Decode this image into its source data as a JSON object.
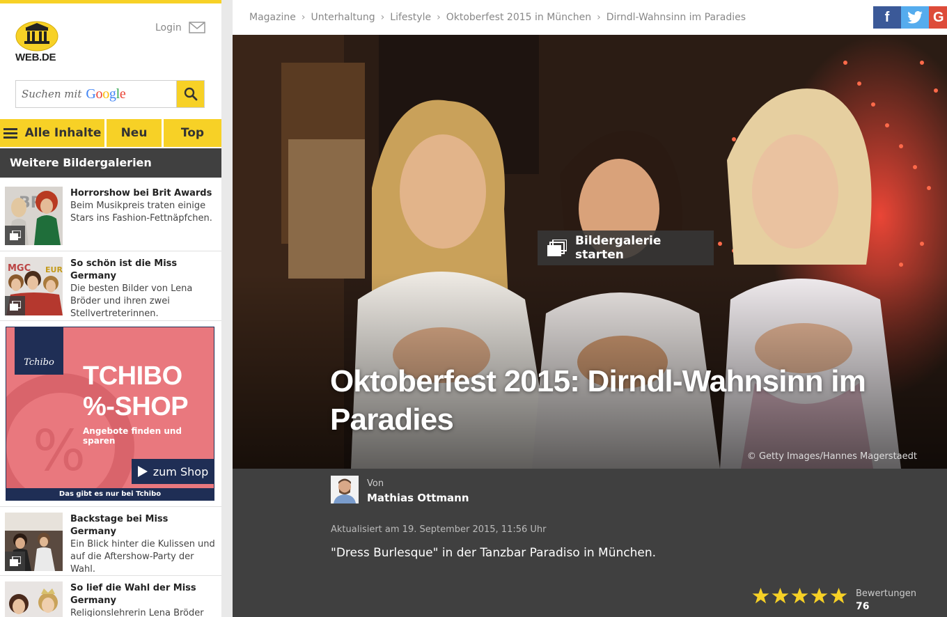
{
  "header": {
    "logo_text": "WEB.DE",
    "login_label": "Login"
  },
  "search": {
    "placeholder_text": "Suchen mit",
    "provider": "Google"
  },
  "nav": {
    "all_label": "Alle Inhalte",
    "new_label": "Neu",
    "top_label": "Top"
  },
  "sidebar": {
    "section_title": "Weitere Bildergalerien",
    "galleries": [
      {
        "title": "Horrorshow bei Brit Awards",
        "text": "Beim Musikpreis traten einige Stars ins Fashion-Fettnäpfchen."
      },
      {
        "title": "So schön ist die Miss Germany",
        "text": "Die besten Bilder von Lena Bröder und ihren zwei Stellvertreterinnen."
      },
      {
        "title": "Backstage bei Miss Germany",
        "text": "Ein Blick hinter die Kulissen und auf die Aftershow-Party der Wahl."
      },
      {
        "title": "So lief die Wahl der Miss Germany",
        "text": "Religionslehrerin Lena Bröder"
      }
    ],
    "ad": {
      "brand": "Tchibo",
      "headline_1": "TCHIBO",
      "headline_2": "%-SHOP",
      "subline": "Angebote finden und sparen",
      "cta": "zum Shop",
      "footer": "Das gibt es nur bei Tchibo"
    }
  },
  "breadcrumbs": [
    "Magazine",
    "Unterhaltung",
    "Lifestyle",
    "Oktoberfest 2015 in München",
    "Dirndl-Wahnsinn im Paradies"
  ],
  "social": {
    "facebook": "f",
    "google": "G"
  },
  "hero": {
    "gallery_button": "Bildergalerie starten",
    "title": "Oktoberfest 2015: Dirndl-Wahnsinn im Paradies",
    "credit": "© Getty Images/Hannes Magerstaedt"
  },
  "article": {
    "by_label": "Von",
    "author": "Mathias Ottmann",
    "updated": "Aktualisiert am 19. September 2015, 11:56 Uhr",
    "teaser": "\"Dress Burlesque\" in der Tanzbar Paradiso in München."
  },
  "rating": {
    "label": "Bewertungen",
    "count": "76",
    "stars": 5,
    "star_color": "#f7d126"
  },
  "colors": {
    "brand_yellow": "#f7d126",
    "dark_panel": "#404040",
    "facebook": "#3b5998",
    "twitter": "#55acee",
    "google": "#dd4b39"
  }
}
